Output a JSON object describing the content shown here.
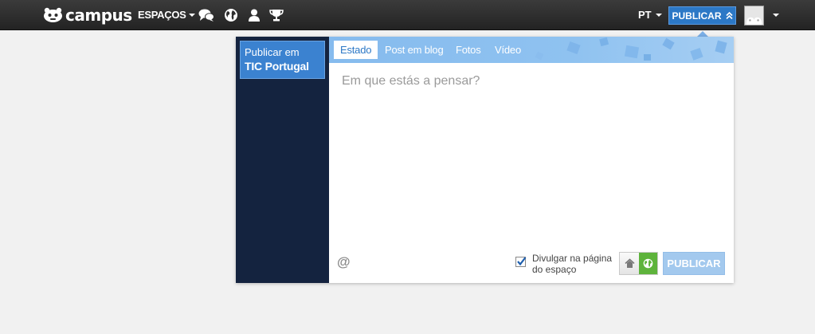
{
  "header": {
    "logo": "campus",
    "logo_icon": "mascot-icon",
    "nav": {
      "espacos_label": "ESPAÇOS",
      "icons": [
        "chat-bubbles-icon",
        "globe-icon",
        "user-icon",
        "trophy-icon"
      ]
    },
    "language": "PT",
    "publish_label": "PUBLICAR",
    "publish_icon": "double-chevron-up-icon",
    "avatar_icon": "avatar-icon"
  },
  "panel": {
    "space": {
      "prefix": "Publicar em",
      "name": "TIC Portugal"
    },
    "tabs": [
      {
        "label": "Estado",
        "active": true
      },
      {
        "label": "Post em blog",
        "active": false
      },
      {
        "label": "Fotos",
        "active": false
      },
      {
        "label": "Vídeo",
        "active": false
      }
    ],
    "status": {
      "value": "",
      "placeholder": "Em que estás a pensar?"
    },
    "mention_symbol": "@",
    "share": {
      "checked": true,
      "label": "Divulgar na página do espaço"
    },
    "visibility": {
      "options": [
        "home-icon",
        "globe-icon"
      ],
      "selected": "globe-icon"
    },
    "submit_label": "PUBLICAR"
  },
  "colors": {
    "topbar": "#2e2e2e",
    "accent": "#2c78c6",
    "panel_side": "#14233f",
    "tabs_bar": "#8fc2f0",
    "visibility_active": "#5eb33c",
    "submit_disabled": "#a3c9ee",
    "page_bg": "#f1f1f1"
  }
}
